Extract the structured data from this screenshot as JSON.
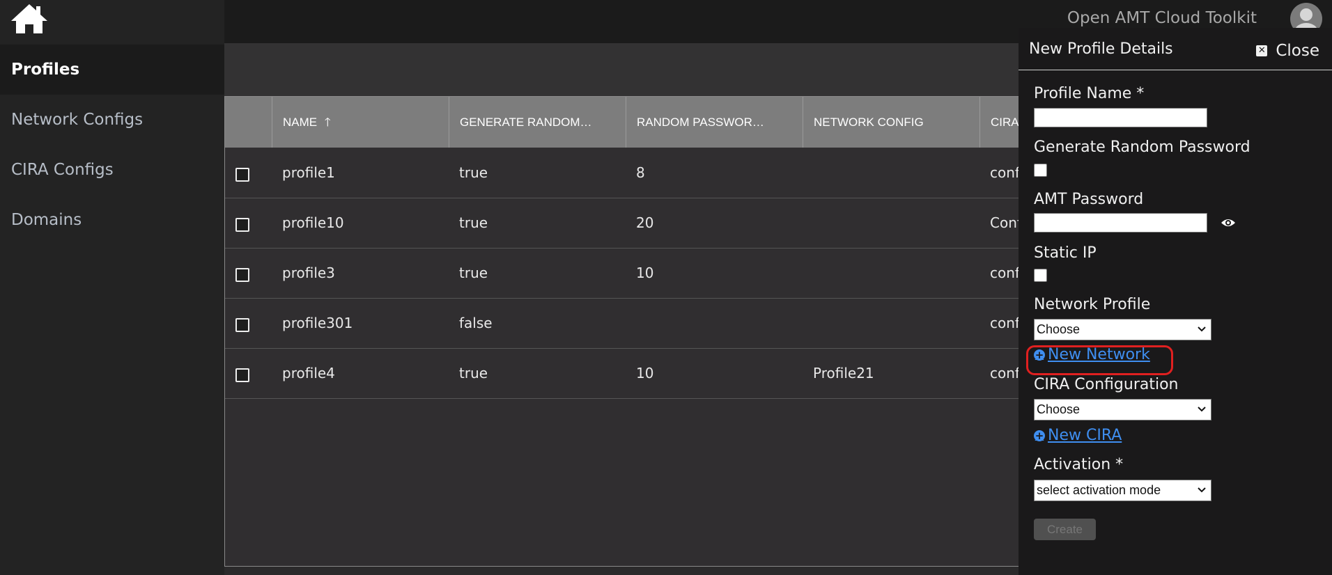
{
  "header": {
    "app_title": "Open AMT Cloud Toolkit"
  },
  "sidebar": {
    "items": [
      {
        "label": "Profiles"
      },
      {
        "label": "Network Configs"
      },
      {
        "label": "CIRA Configs"
      },
      {
        "label": "Domains"
      }
    ]
  },
  "table": {
    "columns": [
      "NAME",
      "GENERATE RANDOM…",
      "RANDOM PASSWOR…",
      "NETWORK CONFIG",
      "CIRA"
    ],
    "rows": [
      {
        "name": "profile1",
        "generate": "true",
        "length": "8",
        "network": "",
        "cira": "confi"
      },
      {
        "name": "profile10",
        "generate": "true",
        "length": "20",
        "network": "",
        "cira": "Conf"
      },
      {
        "name": "profile3",
        "generate": "true",
        "length": "10",
        "network": "",
        "cira": "confi"
      },
      {
        "name": "profile301",
        "generate": "false",
        "length": "",
        "network": "",
        "cira": "confi"
      },
      {
        "name": "profile4",
        "generate": "true",
        "length": "10",
        "network": "Profile21",
        "cira": "confi"
      }
    ]
  },
  "panel": {
    "title": "New Profile Details",
    "close_label": "Close",
    "profile_name_label": "Profile Name *",
    "generate_random_label": "Generate Random Password",
    "amt_password_label": "AMT Password",
    "static_ip_label": "Static IP",
    "network_profile_label": "Network Profile",
    "network_profile_value": "Choose",
    "new_network_link": "New Network",
    "cira_label": "CIRA Configuration",
    "cira_value": "Choose",
    "new_cira_link": "New CIRA",
    "activation_label": "Activation *",
    "activation_value": "select activation mode",
    "create_label": "Create"
  }
}
